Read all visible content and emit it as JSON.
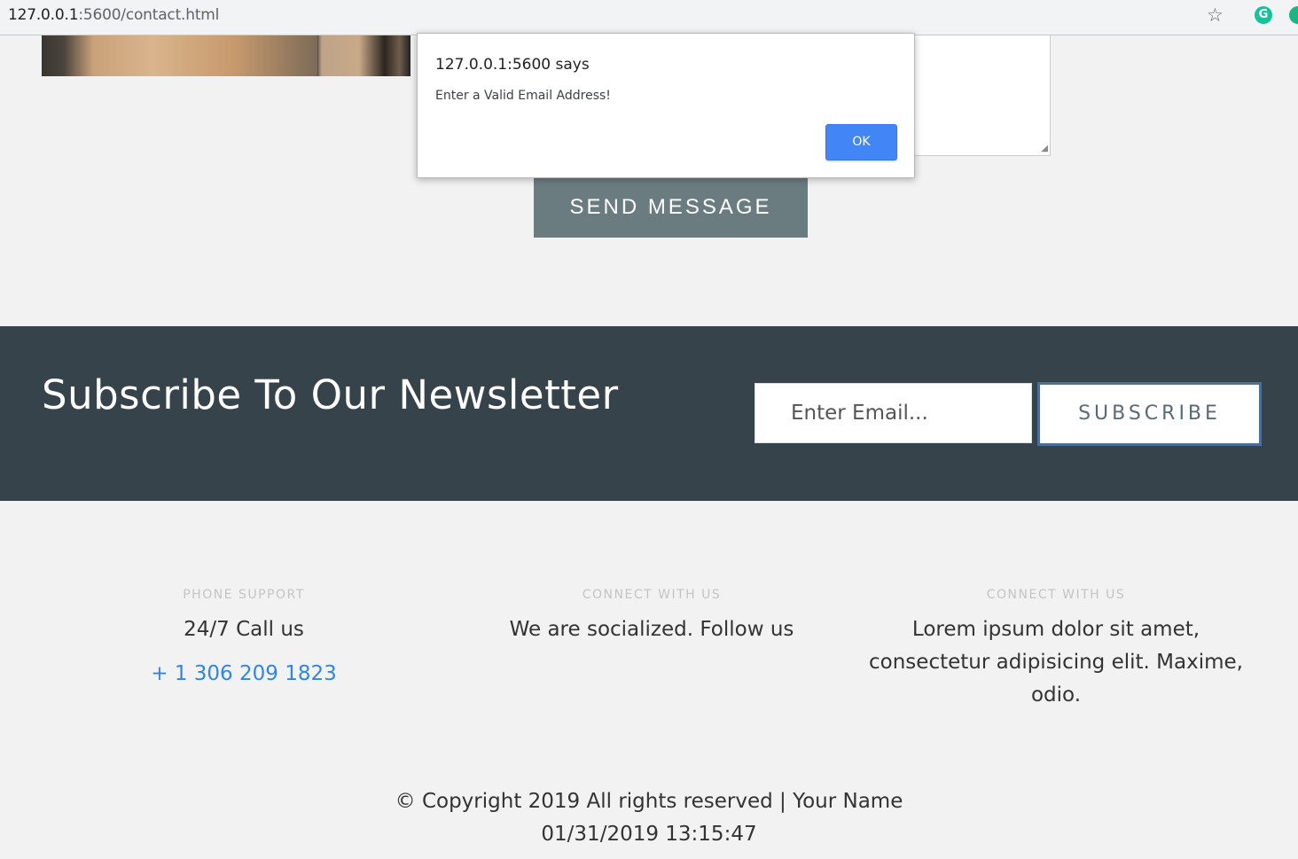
{
  "browser": {
    "url_host": "127.0.0.1",
    "url_path": ":5600/contact.html",
    "extension_letter": "G"
  },
  "contact_form": {
    "send_label": "SEND MESSAGE"
  },
  "alert": {
    "title": "127.0.0.1:5600 says",
    "message": "Enter a Valid Email Address!",
    "ok_label": "OK"
  },
  "newsletter": {
    "title": "Subscribe To Our Newsletter",
    "email_placeholder": "Enter Email...",
    "subscribe_label": "SUBSCRIBE"
  },
  "footer": {
    "columns": [
      {
        "label": "PHONE SUPPORT",
        "text": "24/7 Call us",
        "link": "+ 1 306 209 1823"
      },
      {
        "label": "CONNECT WITH US",
        "text": "We are socialized. Follow us"
      },
      {
        "label": "CONNECT WITH US",
        "text": "Lorem ipsum dolor sit amet, consectetur adipisicing elit. Maxime, odio."
      }
    ],
    "copyright": "© Copyright 2019 All rights reserved | Your Name",
    "datetime": "01/31/2019 13:15:47"
  },
  "colors": {
    "newsletter_bg": "#36434a",
    "send_button_bg": "#6b7c80",
    "ok_button_bg": "#4285f4",
    "link_color": "#2f86e3"
  }
}
